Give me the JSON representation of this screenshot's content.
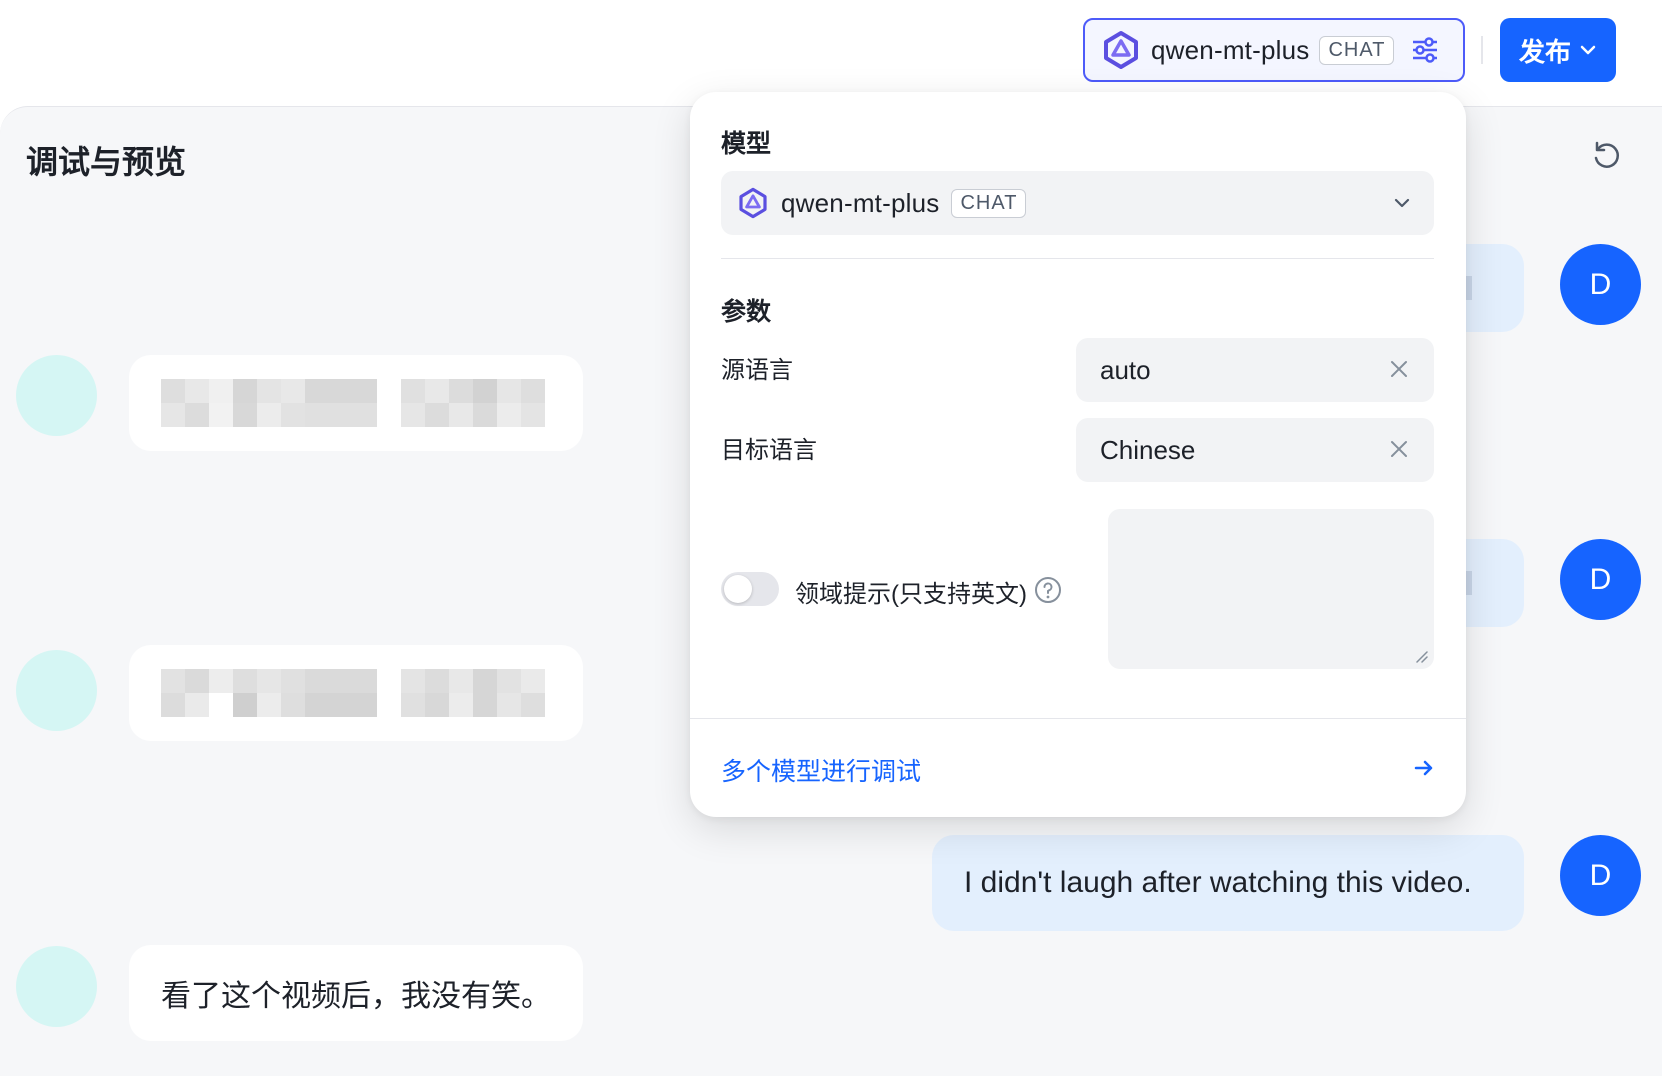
{
  "header": {
    "model_name": "qwen-mt-plus",
    "model_badge": "CHAT",
    "publish_label": "发布"
  },
  "panel": {
    "title": "调试与预览"
  },
  "popover": {
    "model_section": "模型",
    "model_name": "qwen-mt-plus",
    "model_badge": "CHAT",
    "params_section": "参数",
    "source_lang_label": "源语言",
    "source_lang_value": "auto",
    "target_lang_label": "目标语言",
    "target_lang_value": "Chinese",
    "domain_hint_label": "领域提示(只支持英文)",
    "domain_hint_value": "",
    "multi_model_link": "多个模型进行调试"
  },
  "messages": {
    "user_avatar_letter": "D",
    "last_user": "I didn't laugh after watching this video.",
    "last_bot": "看了这个视频后，我没有笑。"
  },
  "colors": {
    "accent": "#1664ff",
    "pill_border": "#4d5bf9",
    "user_bubble": "#e3effd",
    "bot_avatar": "#d5f6f4"
  }
}
